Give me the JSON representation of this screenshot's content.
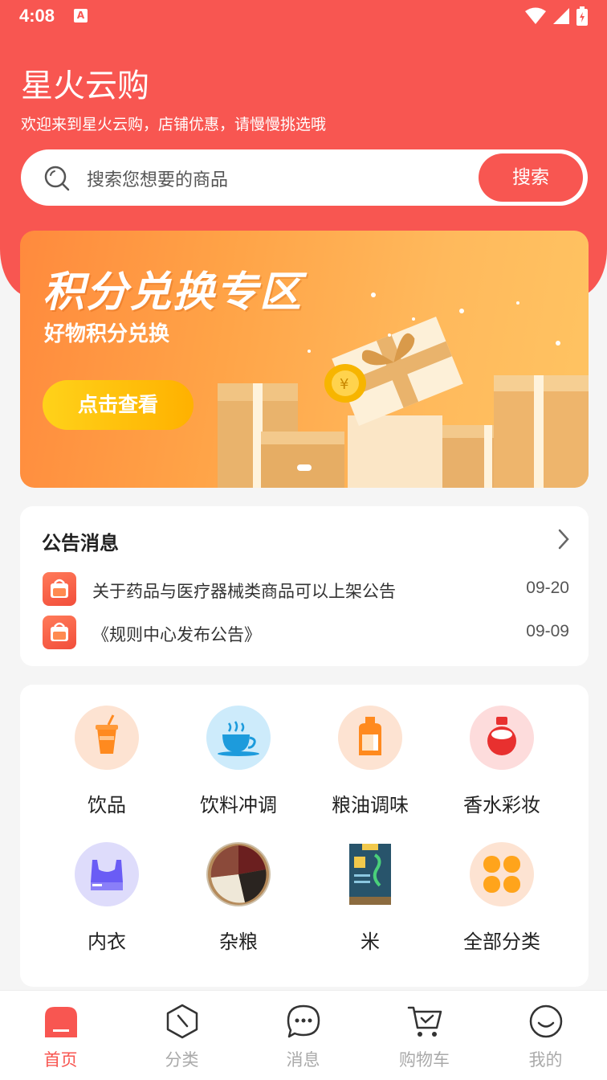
{
  "status_bar": {
    "time": "4:08",
    "notification": "A"
  },
  "header": {
    "title": "星火云购",
    "subtitle": "欢迎来到星火云购，店铺优惠，请慢慢挑选哦"
  },
  "search": {
    "placeholder": "搜索您想要的商品",
    "button": "搜索"
  },
  "banner": {
    "title": "积分兑换专区",
    "subtitle": "好物积分兑换",
    "button": "点击查看"
  },
  "notices": {
    "title": "公告消息",
    "items": [
      {
        "text": "关于药品与医疗器械类商品可以上架公告",
        "date": "09-20"
      },
      {
        "text": "《规则中心发布公告》",
        "date": "09-09"
      }
    ]
  },
  "categories": [
    {
      "label": "饮品",
      "icon": "drink-cup-icon"
    },
    {
      "label": "饮料冲调",
      "icon": "coffee-cup-icon"
    },
    {
      "label": "粮油调味",
      "icon": "oil-bottle-icon"
    },
    {
      "label": "香水彩妆",
      "icon": "perfume-icon"
    },
    {
      "label": "内衣",
      "icon": "underwear-icon"
    },
    {
      "label": "杂粮",
      "icon": "grains-icon"
    },
    {
      "label": "米",
      "icon": "rice-bag-icon"
    },
    {
      "label": "全部分类",
      "icon": "all-categories-icon"
    }
  ],
  "tabs": [
    {
      "label": "首页",
      "icon": "home-icon",
      "active": true
    },
    {
      "label": "分类",
      "icon": "category-icon",
      "active": false
    },
    {
      "label": "消息",
      "icon": "message-icon",
      "active": false
    },
    {
      "label": "购物车",
      "icon": "cart-icon",
      "active": false
    },
    {
      "label": "我的",
      "icon": "profile-icon",
      "active": false
    }
  ],
  "colors": {
    "brand": "#f85651",
    "banner_start": "#ff8a3d",
    "banner_end": "#ffc462"
  }
}
